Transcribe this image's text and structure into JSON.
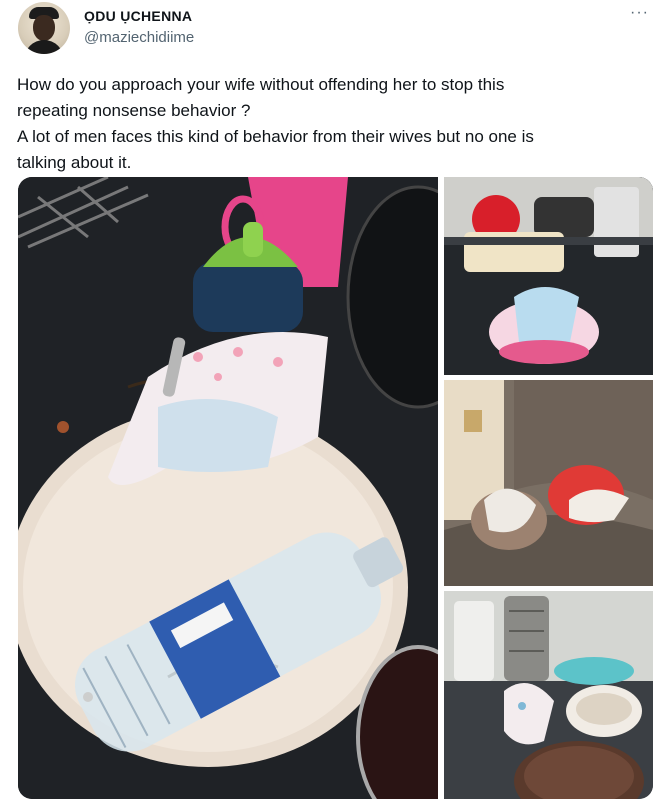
{
  "author": {
    "display_name": "ỌDU ỤCHENNA",
    "handle": "@maziechidiime",
    "avatar_icon": "profile-avatar"
  },
  "tweet": {
    "text_lines": [
      "How do you approach your wife without offending her to stop this",
      "repeating nonsense behavior ?",
      "A lot of men faces this kind of behavior from their wives but no one is",
      "talking about it."
    ]
  },
  "menu": {
    "more_icon": "more-horizontal-icon",
    "glyph": "···"
  },
  "media": {
    "photo_count": 4,
    "photos": [
      {
        "subject": "plate-with-diaper-and-bottle"
      },
      {
        "subject": "kitchen-counter-with-bowl-and-diaper"
      },
      {
        "subject": "couch-with-pot-and-diaper"
      },
      {
        "subject": "counter-with-diaper-and-cake"
      }
    ]
  },
  "colors": {
    "text": "#0f1419",
    "secondary": "#536471",
    "background": "#ffffff"
  }
}
